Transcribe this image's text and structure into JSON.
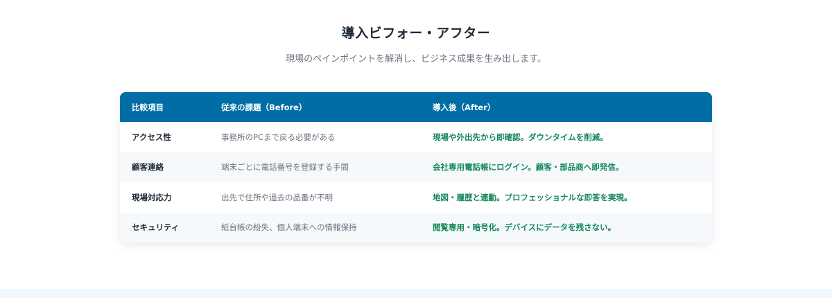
{
  "section": {
    "title": "導入ビフォー・アフター",
    "subtitle": "現場のペインポイントを解消し、ビジネス成果を生み出します。"
  },
  "table": {
    "headers": {
      "item": "比較項目",
      "before": "従来の課題（Before）",
      "after": "導入後（After）"
    },
    "rows": [
      {
        "item": "アクセス性",
        "before": "事務所のPCまで戻る必要がある",
        "after": "現場や外出先から即確認。ダウンタイムを削減。"
      },
      {
        "item": "顧客連絡",
        "before": "端末ごとに電話番号を登録する手間",
        "after": "会社専用電話帳にログイン。顧客・部品商へ即発信。"
      },
      {
        "item": "現場対応力",
        "before": "出先で住所や過去の品番が不明",
        "after": "地図・履歴と連動。プロフェッショナルな即答を実現。"
      },
      {
        "item": "セキュリティ",
        "before": "紙台帳の紛失、個人端末への情報保持",
        "after": "閲覧専用・暗号化。デバイスにデータを残さない。"
      }
    ]
  },
  "colors": {
    "header_bg": "#006ea5",
    "after_text": "#16875a",
    "title_text": "#1f2a37",
    "muted_text": "#6b7280",
    "alt_row_bg": "#f5f9fc"
  }
}
